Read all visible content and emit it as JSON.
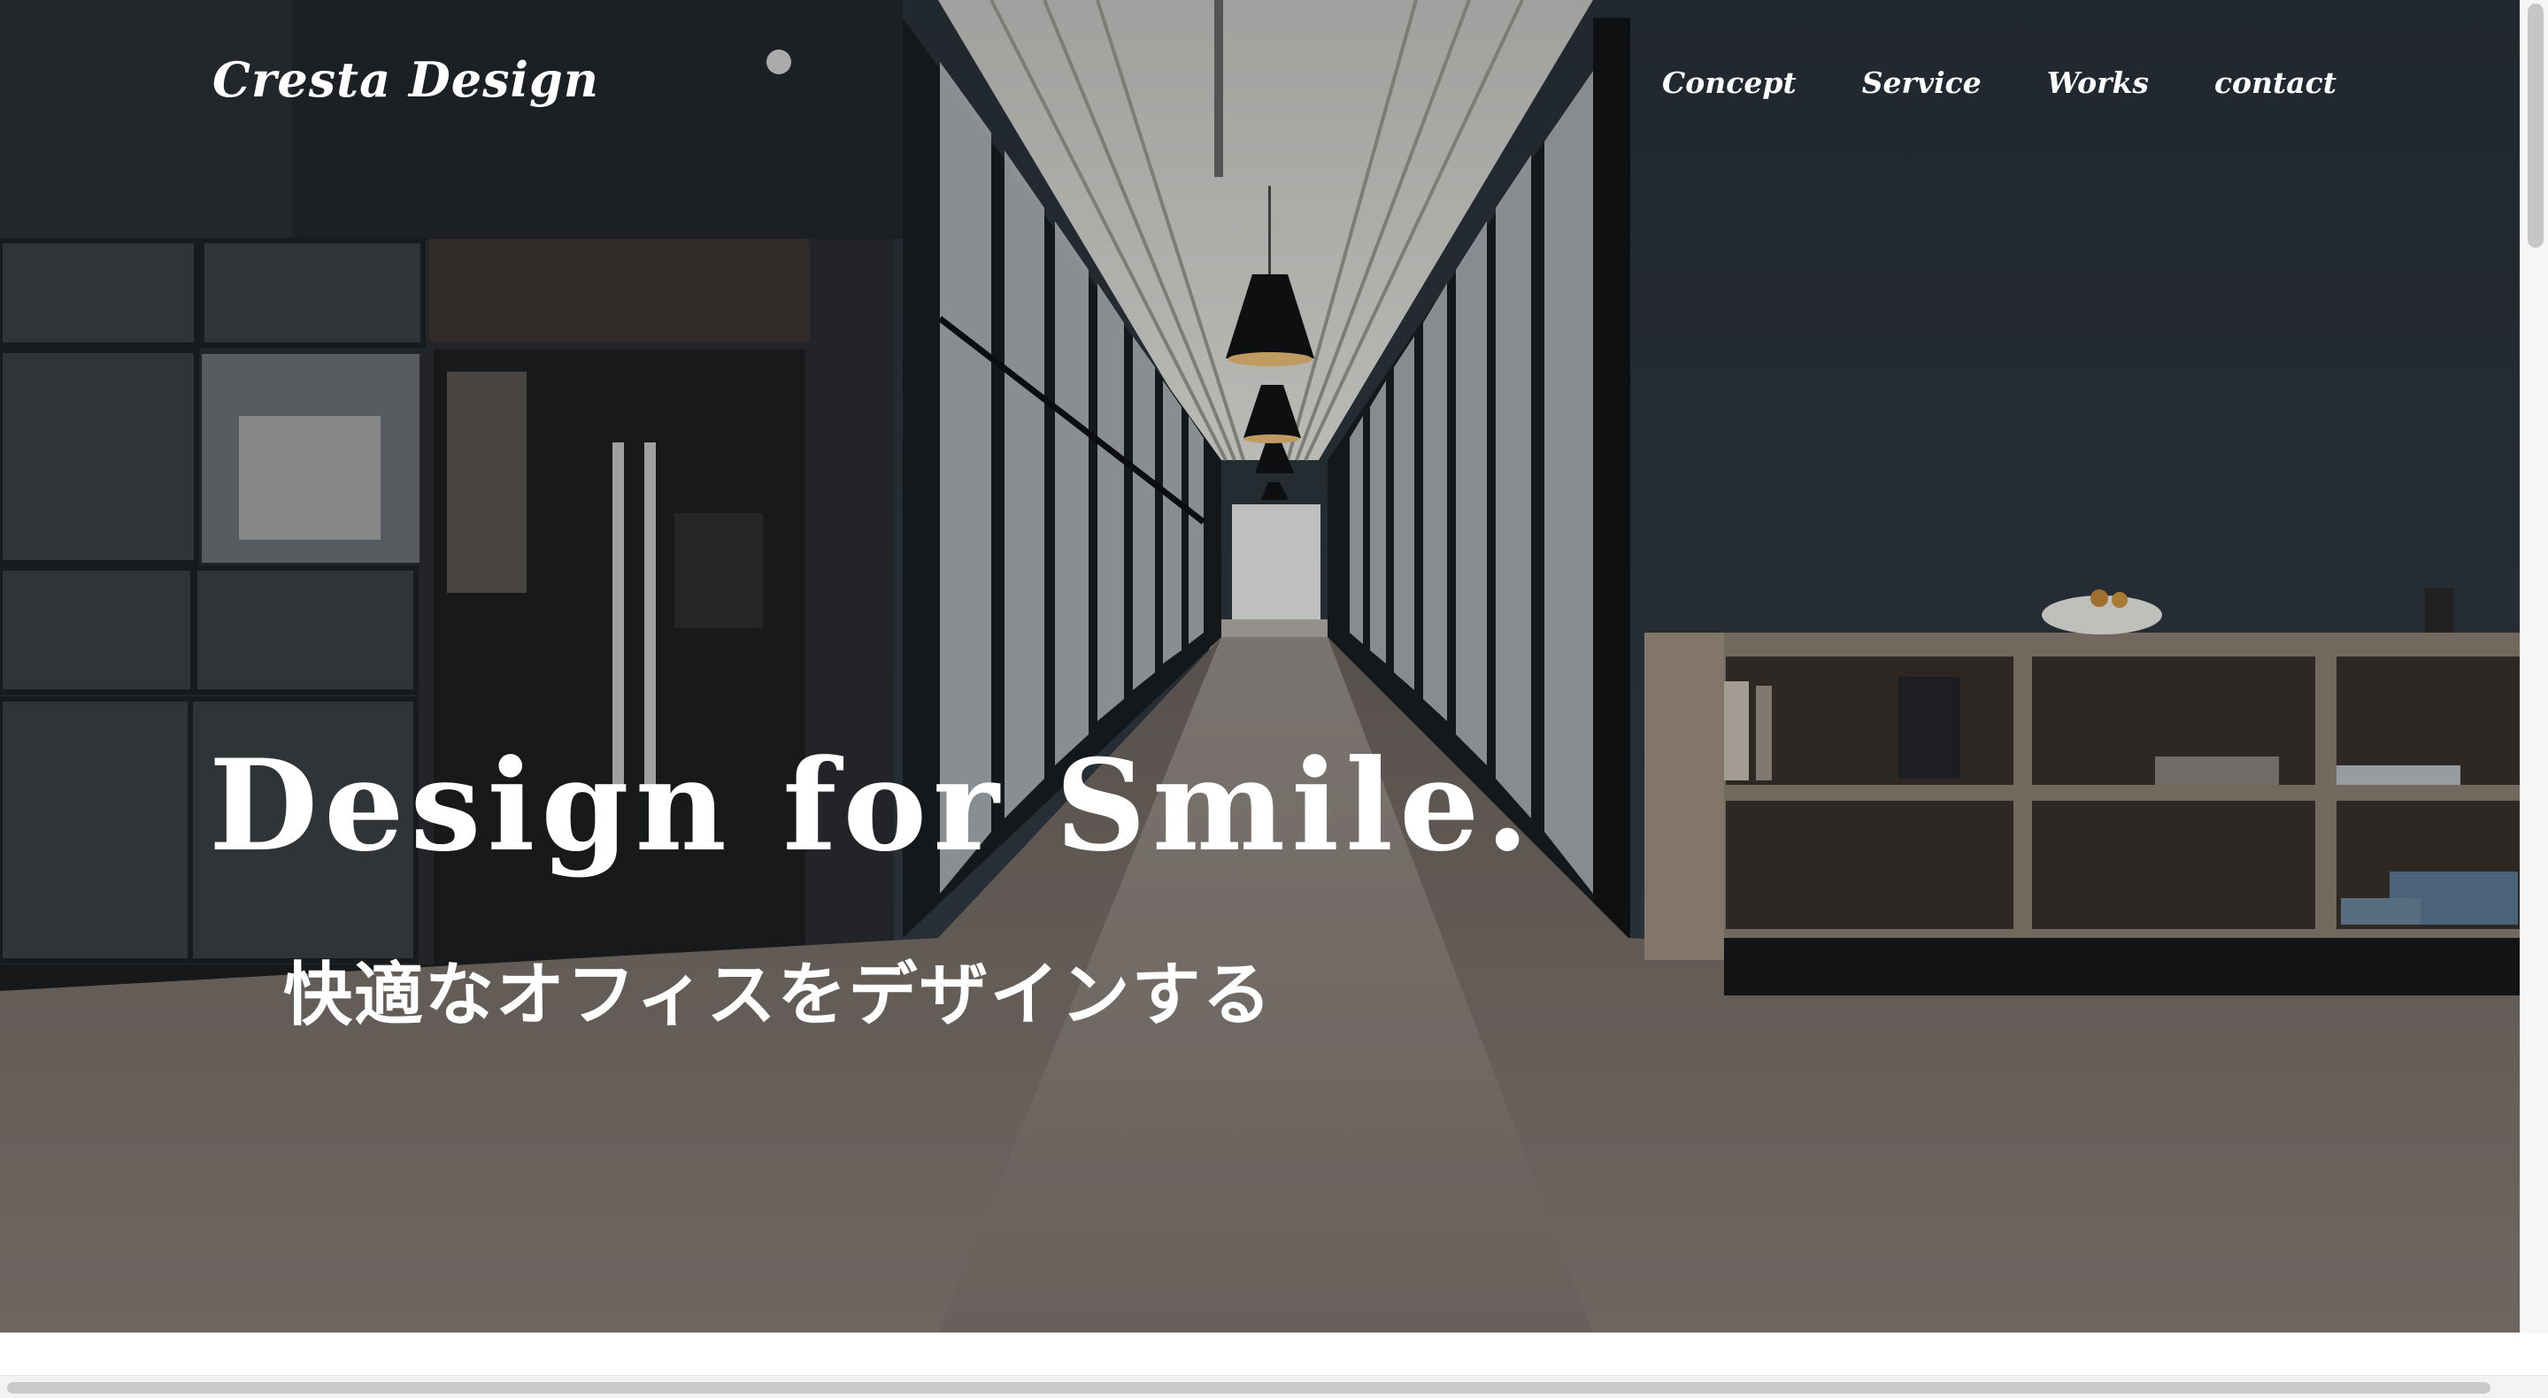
{
  "header": {
    "logo": "Cresta Design",
    "nav": [
      {
        "label": "Concept"
      },
      {
        "label": "Service"
      },
      {
        "label": "Works"
      },
      {
        "label": "contact"
      }
    ]
  },
  "hero": {
    "headline": "Design for Smile.",
    "subheadline": "快適なオフィスをデザインする",
    "image_description_icon": "office-corridor-photo",
    "colors": {
      "text": "#ffffff",
      "wall": "#2f3a44",
      "floor": "#7b726c"
    }
  },
  "scrollbars": {
    "vertical_thumb_position": 0,
    "horizontal_thumb_position": 0
  }
}
